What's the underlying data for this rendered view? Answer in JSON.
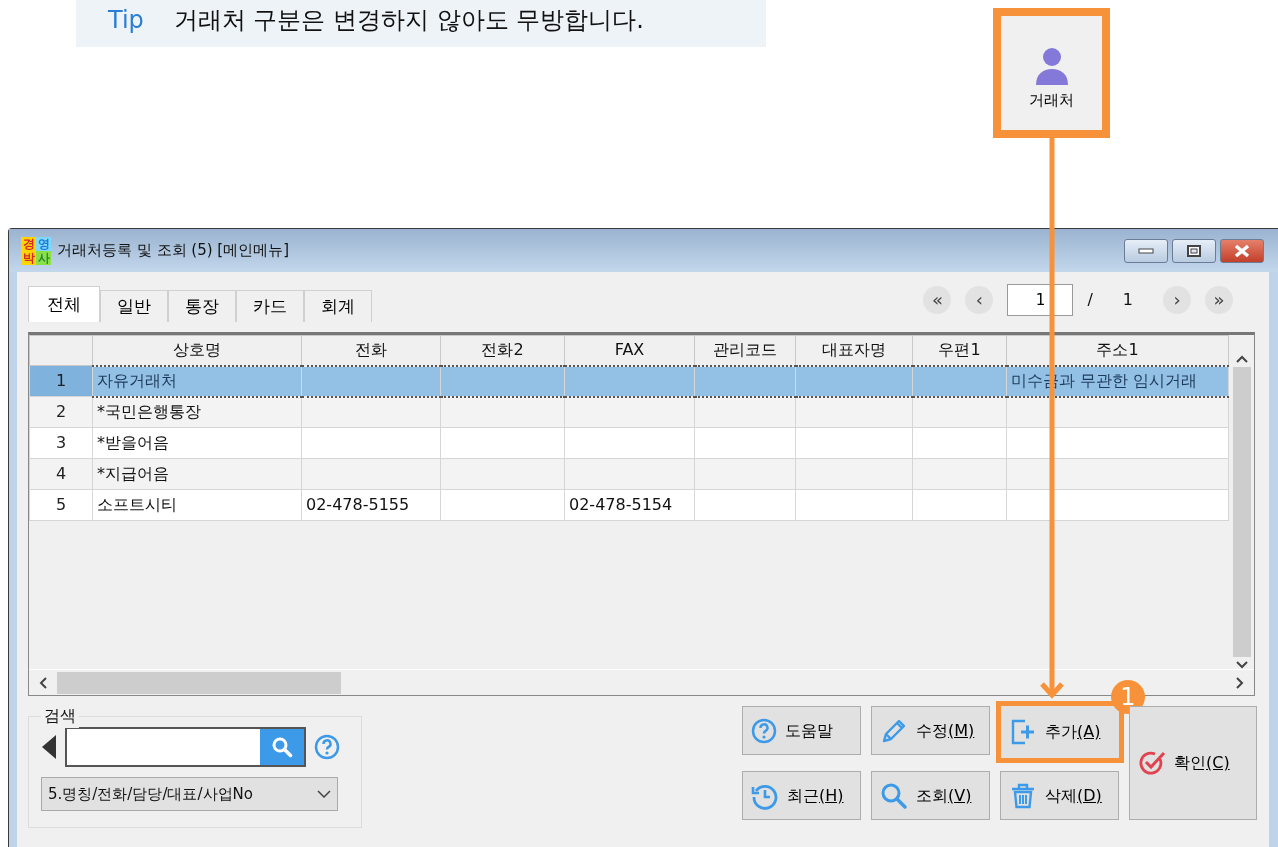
{
  "tip": {
    "label": "Tip",
    "text": "거래처 구분은 변경하지 않아도 무방합니다."
  },
  "toolbar_button": {
    "label": "거래처",
    "highlighted": true
  },
  "window": {
    "title": "거래처등록 및 조회 (5)  [메인메뉴]",
    "logo": [
      "경",
      "영",
      "박",
      "사"
    ]
  },
  "tabs": [
    {
      "label": "전체",
      "selected": true
    },
    {
      "label": "일반",
      "selected": false
    },
    {
      "label": "통장",
      "selected": false
    },
    {
      "label": "카드",
      "selected": false
    },
    {
      "label": "회계",
      "selected": false
    }
  ],
  "pager": {
    "first": "«",
    "prev": "‹",
    "current": "1",
    "separator": "/",
    "total": "1",
    "next": "›",
    "last": "»"
  },
  "table": {
    "columns": [
      "상호명",
      "전화",
      "전화2",
      "FAX",
      "관리코드",
      "대표자명",
      "우편1",
      "주소1"
    ],
    "rows": [
      {
        "number": "1",
        "selected": true,
        "cells": [
          "자유거래처",
          "",
          "",
          "",
          "",
          "",
          "",
          "미수금과 무관한 임시거래"
        ]
      },
      {
        "number": "2",
        "selected": false,
        "cells": [
          "*국민은행통장",
          "",
          "",
          "",
          "",
          "",
          "",
          ""
        ]
      },
      {
        "number": "3",
        "selected": false,
        "cells": [
          "*받을어음",
          "",
          "",
          "",
          "",
          "",
          "",
          ""
        ]
      },
      {
        "number": "4",
        "selected": false,
        "cells": [
          "*지급어음",
          "",
          "",
          "",
          "",
          "",
          "",
          ""
        ]
      },
      {
        "number": "5",
        "selected": false,
        "cells": [
          "소프트시티",
          "02-478-5155",
          "",
          "02-478-5154",
          "",
          "",
          "",
          ""
        ]
      }
    ]
  },
  "search": {
    "label": "검색",
    "mode": "5.명칭/전화/담당/대표/사업No"
  },
  "buttons": [
    {
      "kind": "help",
      "label": "도움말",
      "highlighted": false
    },
    {
      "kind": "edit",
      "label": "수정",
      "accel": "(M)",
      "highlighted": false
    },
    {
      "kind": "add",
      "label": "추가",
      "accel": "(A)",
      "highlighted": true,
      "step": "1"
    },
    {
      "kind": "history",
      "label": "최근",
      "accel": "(H)",
      "highlighted": false
    },
    {
      "kind": "search",
      "label": "조회",
      "accel": "(V)",
      "highlighted": false
    },
    {
      "kind": "delete",
      "label": "삭제",
      "accel": "(D)",
      "highlighted": false
    },
    {
      "kind": "confirm",
      "label": "확인",
      "accel": "(C)",
      "highlighted": false
    }
  ]
}
